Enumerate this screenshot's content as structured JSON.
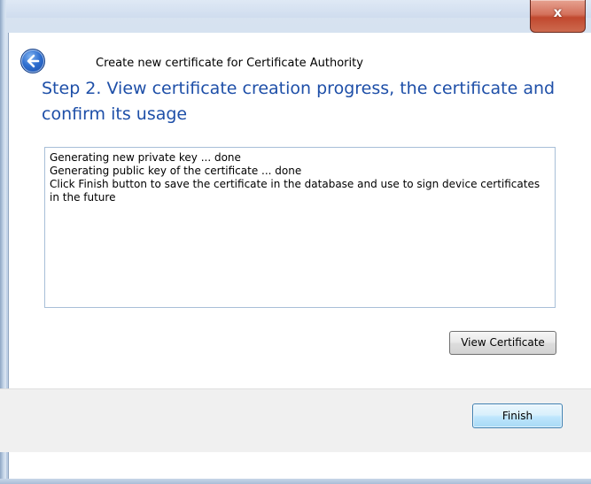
{
  "window": {
    "title": "Create new certificate for Certificate Authority",
    "close_label": "x"
  },
  "wizard": {
    "step_title": "Step 2. View certificate creation progress, the certificate and confirm its usage",
    "log_lines": [
      "Generating new private key ... done",
      "Generating public key of the certificate ... done",
      "Click Finish button to save the certificate in the database and use to sign device certificates in the future"
    ],
    "view_certificate_label": "View Certificate",
    "finish_label": "Finish"
  },
  "icons": {
    "back": "back-arrow-icon",
    "close": "close-icon"
  },
  "colors": {
    "title_blue": "#1e4fa8",
    "close_red": "#c1492f",
    "frame": "#c6d6ea",
    "footer": "#f0f0f0"
  }
}
